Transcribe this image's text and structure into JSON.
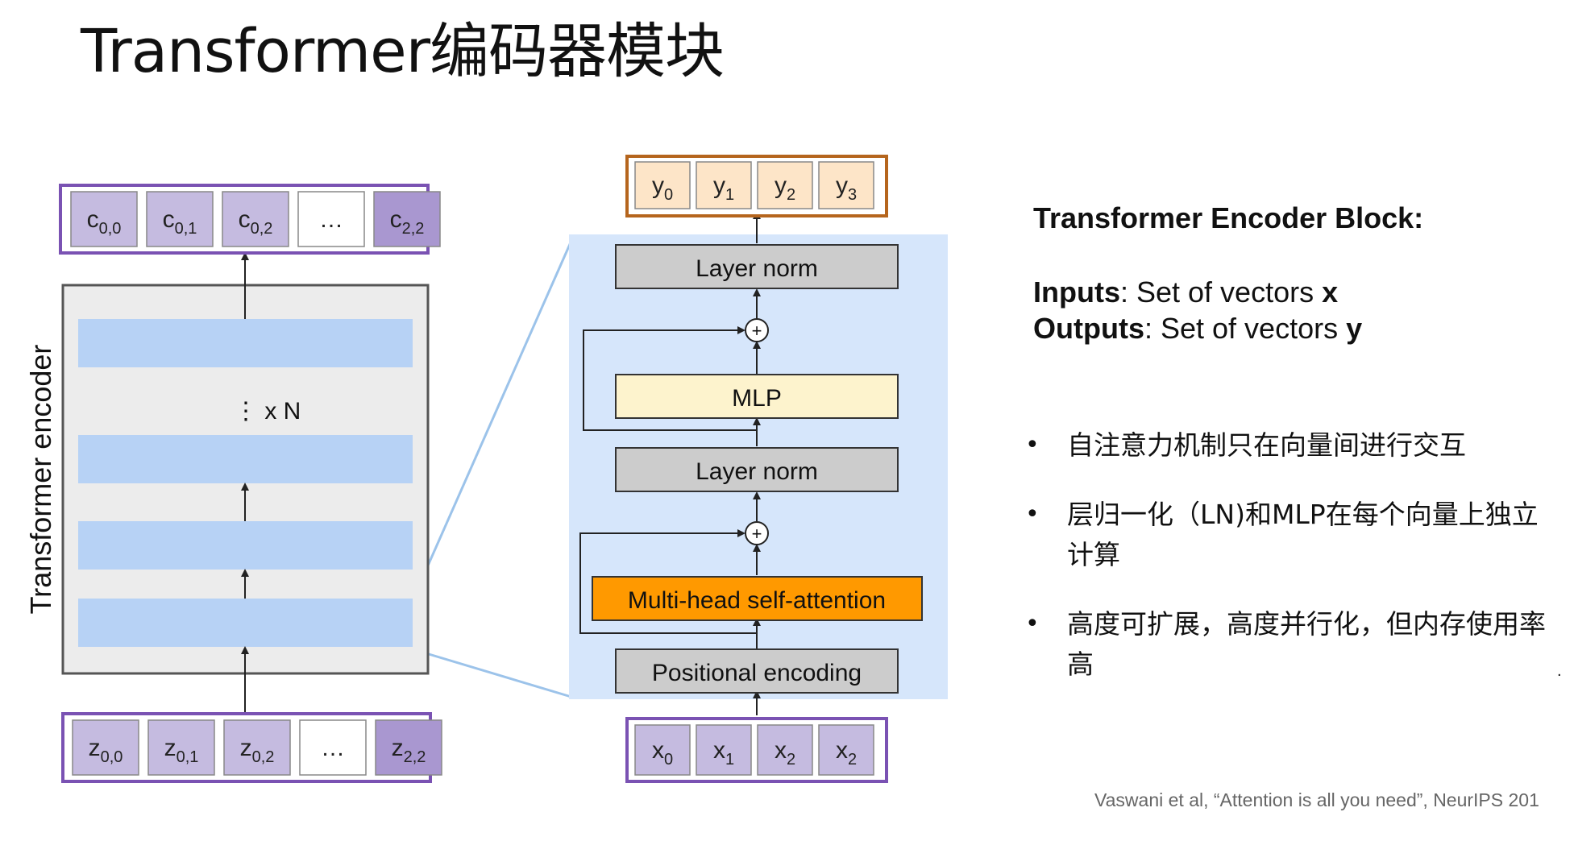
{
  "title": "Transformer编码器模块",
  "left_stack": {
    "encoder_label": "Transformer encoder",
    "repeat_label": "⋮ x N",
    "outputs": [
      {
        "base": "c",
        "sub": "0,0"
      },
      {
        "base": "c",
        "sub": "0,1"
      },
      {
        "base": "c",
        "sub": "0,2"
      },
      {
        "base": "…",
        "sub": ""
      },
      {
        "base": "c",
        "sub": "2,2"
      }
    ],
    "inputs": [
      {
        "base": "z",
        "sub": "0,0"
      },
      {
        "base": "z",
        "sub": "0,1"
      },
      {
        "base": "z",
        "sub": "0,2"
      },
      {
        "base": "…",
        "sub": ""
      },
      {
        "base": "z",
        "sub": "2,2"
      }
    ]
  },
  "block": {
    "outputs": [
      {
        "base": "y",
        "sub": "0"
      },
      {
        "base": "y",
        "sub": "1"
      },
      {
        "base": "y",
        "sub": "2"
      },
      {
        "base": "y",
        "sub": "3"
      }
    ],
    "inputs": [
      {
        "base": "x",
        "sub": "0"
      },
      {
        "base": "x",
        "sub": "1"
      },
      {
        "base": "x",
        "sub": "2"
      },
      {
        "base": "x",
        "sub": "2"
      }
    ],
    "layer_norm_top": "Layer norm",
    "mlp": "MLP",
    "layer_norm_bottom": "Layer norm",
    "attention": "Multi-head self-attention",
    "positional": "Positional encoding",
    "plus": "+"
  },
  "panel": {
    "heading": "Transformer Encoder Block:",
    "inputs_label": "Inputs",
    "inputs_text": ": Set of vectors ",
    "inputs_var": "x",
    "outputs_label": "Outputs",
    "outputs_text": ": Set of vectors ",
    "outputs_var": "y",
    "bullet_symbol": "•",
    "bullets": [
      "自注意力机制只在向量间进行交互",
      "层归一化（LN)和MLP在每个向量上独立计算",
      "高度可扩展，高度并行化，但内存使用率高"
    ]
  },
  "citation": "Vaswani et al, “Attention is all you need”, NeurIPS 201",
  "stray_mark": "."
}
